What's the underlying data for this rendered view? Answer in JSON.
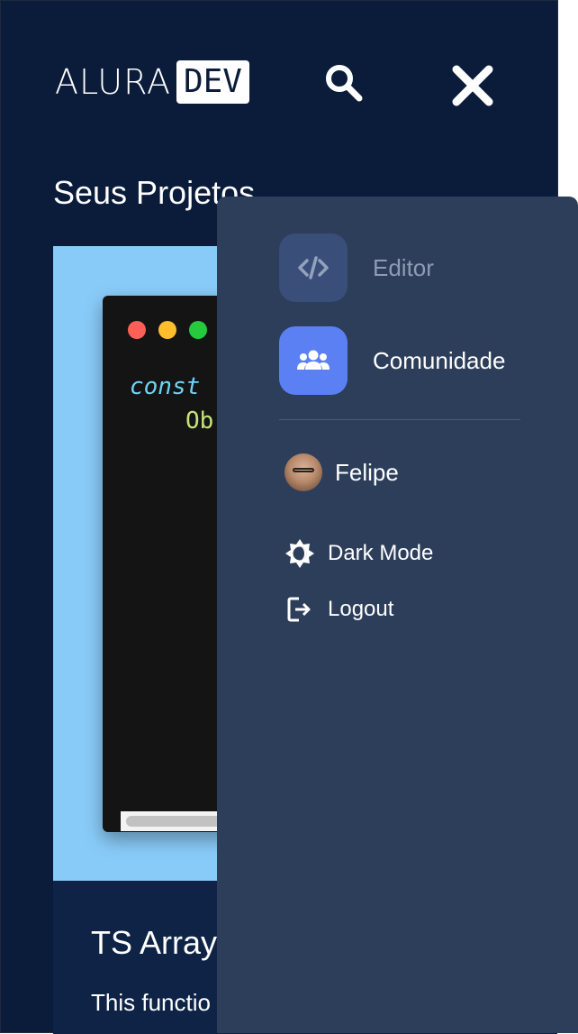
{
  "header": {
    "logo_text": "ALURA",
    "logo_badge": "DEV"
  },
  "projects": {
    "title": "Seus Projetos",
    "card": {
      "code_line1": "const ",
      "code_line2": "Ob",
      "title": "TS Array",
      "description": "This functio objects wit"
    }
  },
  "menu": {
    "items": [
      {
        "label": "Editor",
        "icon": "code-icon"
      },
      {
        "label": "Comunidade",
        "icon": "users-icon"
      }
    ],
    "user": {
      "name": "Felipe"
    },
    "options": [
      {
        "label": "Dark Mode",
        "icon": "dark-mode-icon"
      },
      {
        "label": "Logout",
        "icon": "logout-icon"
      }
    ]
  },
  "colors": {
    "background": "#0b1c3b",
    "drawer": "#2d3e5b",
    "accent": "#5b80f4",
    "card": "#89cbf8"
  }
}
